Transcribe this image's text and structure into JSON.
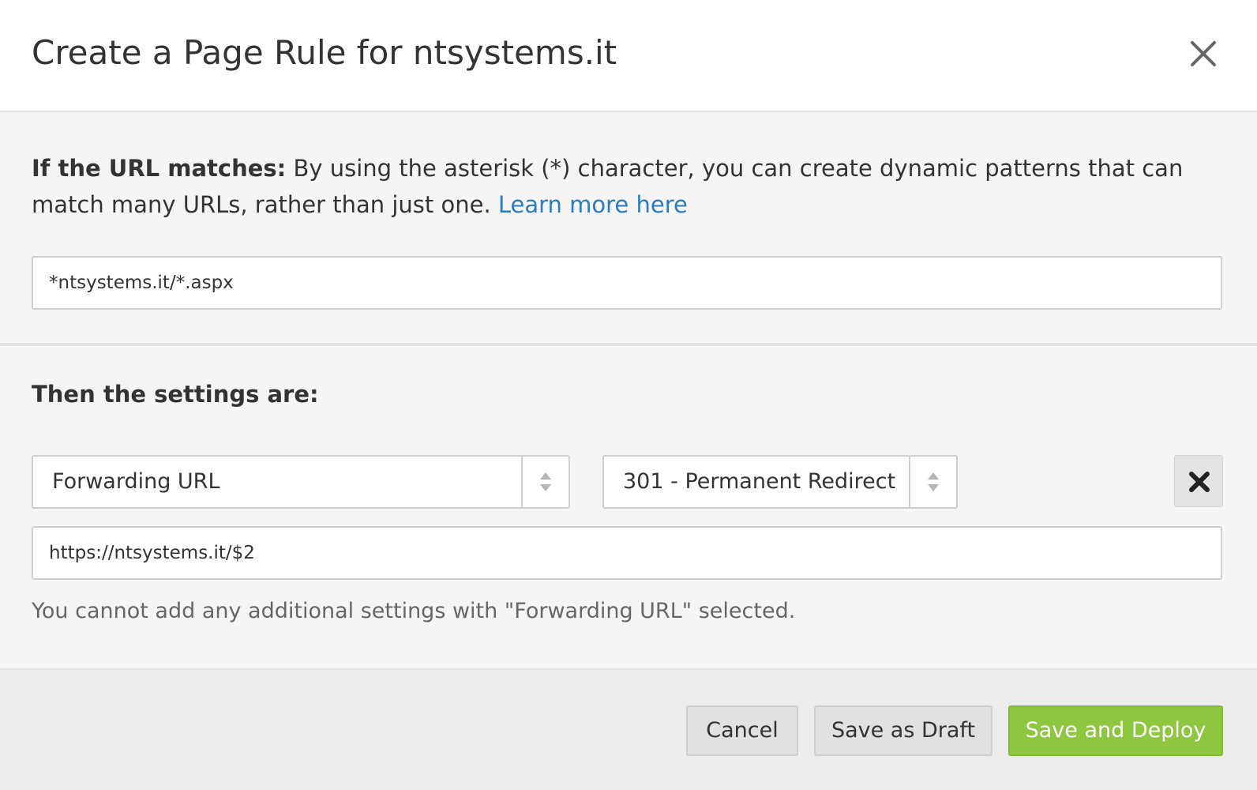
{
  "dialog": {
    "title": "Create a Page Rule for ntsystems.it"
  },
  "url_section": {
    "label_bold": "If the URL matches:",
    "description": " By using the asterisk (*) character, you can create dynamic patterns that can match many URLs, rather than just one. ",
    "learn_more_link": "Learn more here",
    "url_pattern_value": "*ntsystems.it/*.aspx"
  },
  "settings_section": {
    "heading": "Then the settings are:",
    "setting_select_value": "Forwarding URL",
    "redirect_select_value": "301 - Permanent Redirect",
    "forward_url_value": "https://ntsystems.it/$2",
    "info_text": "You cannot add any additional settings with \"Forwarding URL\" selected."
  },
  "footer": {
    "cancel_label": "Cancel",
    "draft_label": "Save as Draft",
    "deploy_label": "Save and Deploy"
  },
  "colors": {
    "link": "#2f7bbf",
    "primary_button": "#8dc63f",
    "section_background": "#f5f5f5",
    "footer_background": "#ececec"
  },
  "icons": {
    "close": "close-icon",
    "select_arrows": "sort-arrows-icon",
    "remove": "remove-icon"
  }
}
